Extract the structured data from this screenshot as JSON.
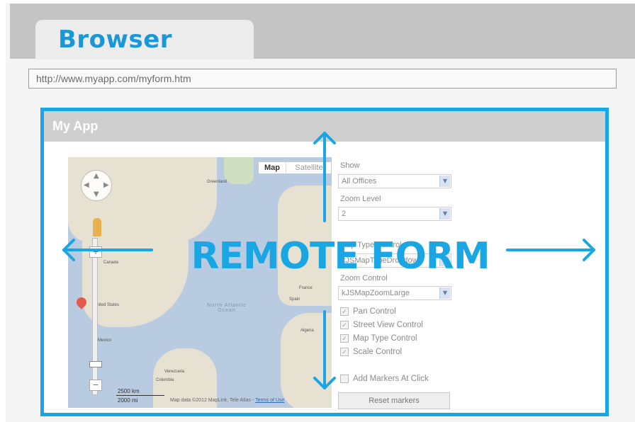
{
  "browser": {
    "tab_title": "Browser",
    "url": "http://www.myapp.com/myform.htm"
  },
  "app": {
    "title": "My App"
  },
  "map": {
    "toggle_map": "Map",
    "toggle_satellite": "Satellite",
    "labels": {
      "greenland": "Greenland",
      "canada": "Canada",
      "united_states": "United States",
      "mexico": "Mexico",
      "venezuela": "Venezuela",
      "colombia": "Colombia",
      "france": "France",
      "spain": "Spain",
      "algeria": "Algeria",
      "north_atlantic_ocean": "North Atlantic Ocean"
    },
    "scale_top": "2500 km",
    "scale_bottom": "2000 mi",
    "attribution": "Map data ©2012 MapLink, Tele Atlas -",
    "terms": "Terms of Use"
  },
  "controls": {
    "show_label": "Show",
    "show_value": "All Offices",
    "zoom_level_label": "Zoom Level",
    "zoom_level_value": "2",
    "map_type_label": "Map Type Control",
    "map_type_value": "kJSMapTypeDropdown",
    "zoom_control_label": "Zoom Control",
    "zoom_control_value": "kJSMapZoomLarge",
    "checkboxes": [
      {
        "label": "Pan Control",
        "checked": true
      },
      {
        "label": "Street View Control",
        "checked": true
      },
      {
        "label": "Map Type Control",
        "checked": true
      },
      {
        "label": "Scale Control",
        "checked": true
      }
    ],
    "add_markers_label": "Add Markers At Click",
    "add_markers_checked": false,
    "reset_button": "Reset markers"
  },
  "overlay": {
    "text": "REMOTE FORM",
    "color": "#19a6e2"
  },
  "colors": {
    "brand_blue": "#1a98d6",
    "chrome_gray": "#c4c4c4",
    "app_header": "#cfcfcf"
  }
}
